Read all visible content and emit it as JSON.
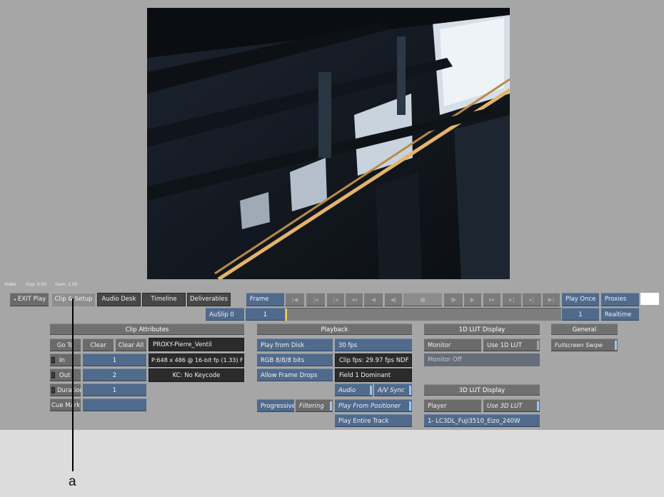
{
  "info_bar": {
    "video": "Video",
    "exp": "Exp: 0.00",
    "gam": "Gam: 1.00"
  },
  "tabs": {
    "exit": "EXIT Play",
    "clip_setup": "Clip & Setup",
    "audio_desk": "Audio Desk",
    "timeline": "Timeline",
    "deliverables": "Deliverables"
  },
  "transport": {
    "frame_label": "Frame",
    "play_once": "Play Once",
    "proxies": "Proxies",
    "auslip": "AuSlip 0",
    "auslip_value": "1",
    "frame_value": "1",
    "realtime": "Realtime",
    "icons": [
      "go-start-icon",
      "prev-mark-icon",
      "prev-key-icon",
      "prev-frame-group-icon",
      "step-back-icon",
      "play-reverse-icon",
      "stop-icon",
      "play-forward-icon",
      "play-icon",
      "next-frame-group-icon",
      "next-key-icon",
      "next-mark-icon",
      "go-end-icon"
    ]
  },
  "clip_attributes": {
    "header": "Clip Attributes",
    "goto": "Go To",
    "clear": "Clear",
    "clear_all": "Clear All",
    "in": "In",
    "in_value": "1",
    "out": "Out",
    "out_value": "2",
    "duration": "Duration",
    "duration_value": "1",
    "cue_mark": "Cue Mark",
    "clip_name": "PROXY-Pierre_Ventil",
    "format": "P:648 x 486 @ 16-bit fp (1.33) F",
    "keycode": "KC: No Keycode"
  },
  "playback": {
    "header": "Playback",
    "play_from_disk": "Play from Disk",
    "fps": "30 fps",
    "rgb": "RGB 8/8/8 bits",
    "clip_fps": "Clip fps: 29.97 fps NDF",
    "allow_frame_drops": "Allow Frame Drops",
    "field": "Field 1 Dominant",
    "audio": "Audio",
    "av_sync": "A/V Sync",
    "progressive": "Progressive",
    "filtering": "Filtering",
    "play_from_positioner": "Play From Positioner",
    "play_entire_track": "Play Entire Track"
  },
  "lut1d": {
    "header": "1D LUT Display",
    "monitor": "Monitor",
    "use_1d_lut": "Use 1D LUT",
    "monitor_off": "Monitor Off"
  },
  "lut3d": {
    "header": "3D LUT Display",
    "player": "Player",
    "use_3d_lut": "Use 3D LUT",
    "lut_name": "1- LC3DL_Fuji3510_Eizo_240W"
  },
  "general": {
    "header": "General",
    "fullscreen_swipe": "Fullscreen Swipe"
  },
  "annotation": {
    "label": "a"
  },
  "colors": {
    "app_bg": "#a6a6a6",
    "blue_button": "#506a8c",
    "gray_button": "#6b6b6b",
    "toggle_on": "#9cc6ee"
  }
}
